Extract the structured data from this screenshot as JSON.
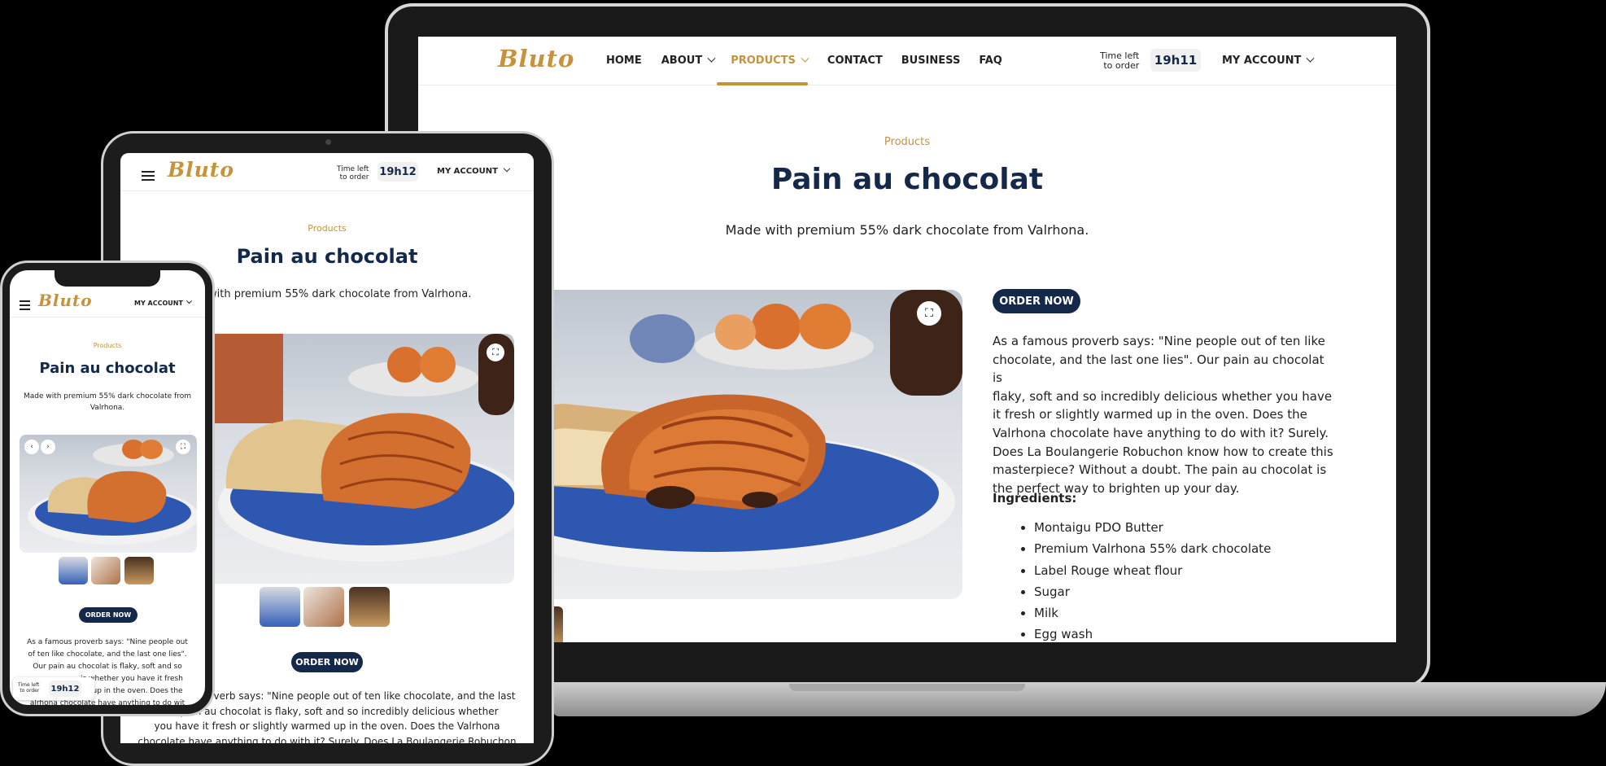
{
  "brand": {
    "logo_text": "Bluto",
    "navy": "#14294a",
    "gold": "#c8923a"
  },
  "nav": {
    "items": [
      {
        "label": "HOME"
      },
      {
        "label": "ABOUT"
      },
      {
        "label": "PRODUCTS"
      },
      {
        "label": "CONTACT"
      },
      {
        "label": "BUSINESS"
      },
      {
        "label": "FAQ"
      }
    ],
    "active": "PRODUCTS",
    "time_left_line1": "Time left",
    "time_left_line2": "to order",
    "my_account": "MY ACCOUNT"
  },
  "timers": {
    "laptop": "19h11",
    "tablet": "19h12",
    "phone": "19h12"
  },
  "product": {
    "breadcrumb": "Products",
    "title": "Pain au chocolat",
    "subtitle": "Made with premium 55% dark chocolate from Valrhona.",
    "subtitle_phone_line1": "Made with premium 55% dark chocolate from",
    "subtitle_phone_line2": "Valrhona.",
    "subtitle_tablet_visible": "with premium 55% dark chocolate from Valrhona.",
    "order_button": "ORDER NOW",
    "description_lines": [
      "As a famous proverb says: \"Nine people out of ten like",
      "chocolate, and the last one lies\". Our pain au chocolat is",
      "flaky, soft and so incredibly delicious whether you have",
      "it fresh or slightly warmed up in the oven. Does the",
      "Valrhona chocolate have anything to do with it? Surely.",
      "Does La Boulangerie Robuchon know how to create this",
      "masterpiece? Without a doubt. The pain au chocolat is",
      "the perfect way to brighten up your day."
    ],
    "ingredients_label": "Ingredients:",
    "ingredients": [
      "Montaigu PDO Butter",
      "Premium Valrhona 55% dark chocolate",
      "Label Rouge wheat flour",
      "Sugar",
      "Milk",
      "Egg wash"
    ],
    "tablet_desc_lines": [
      "roverb says: \"Nine people out of ten like chocolate, and the last",
      "pain au chocolat is flaky, soft and so incredibly delicious whether",
      "you have it fresh or slightly warmed up in the oven. Does the Valrhona",
      "chocolate have anything to do with it? Surely. Does La Boulangerie Robuchon"
    ],
    "phone_desc_lines": [
      "As a famous proverb says: \"Nine people out",
      "of ten like chocolate, and the last one lies\".",
      "Our pain au chocolat is flaky, soft and so",
      "is whether you have it fresh",
      "ed up in the oven. Does the",
      "alrhona chocolate have anything to do wit"
    ]
  }
}
